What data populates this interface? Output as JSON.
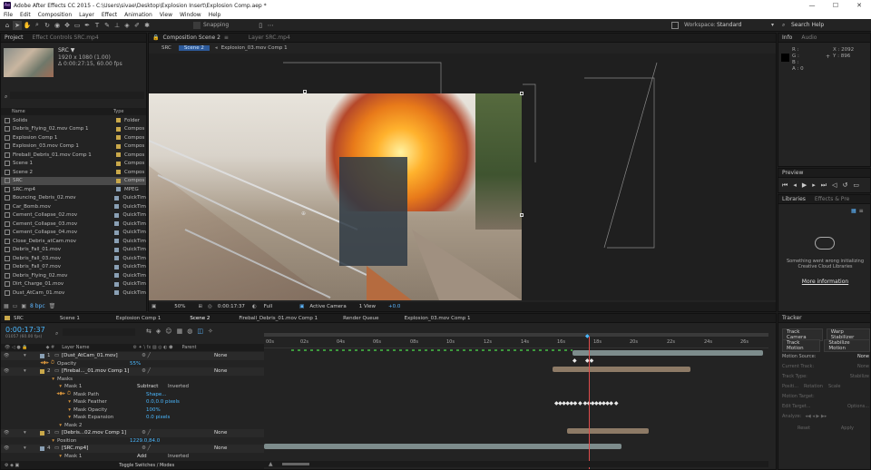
{
  "window": {
    "title": "Adobe After Effects CC 2015 - C:\\Users\\sivae\\Desktop\\Explosion Insert\\Explosion Comp.aep *",
    "controls": [
      "—",
      "☐",
      "✕"
    ]
  },
  "menu": [
    "File",
    "Edit",
    "Composition",
    "Layer",
    "Effect",
    "Animation",
    "View",
    "Window",
    "Help"
  ],
  "toolbar": {
    "snapping": "Snapping",
    "workspace_label": "Workspace:",
    "workspace_value": "Standard",
    "search_help": "Search Help"
  },
  "project": {
    "tab": "Project",
    "effect_controls": "Effect Controls SRC.mp4",
    "selected_name": "SRC ▼",
    "selected_res": "1920 x 1080 (1.00)",
    "selected_dur": "Δ 0:00:27:15, 60.00 fps",
    "col_name": "Name",
    "col_type": "Type",
    "bpc": "8 bpc",
    "items": [
      {
        "name": "Solids",
        "type": "Folder"
      },
      {
        "name": "Debris_Flying_02.mov Comp 1",
        "type": "Compos"
      },
      {
        "name": "Explosion Comp 1",
        "type": "Compos"
      },
      {
        "name": "Explosion_03.mov Comp 1",
        "type": "Compos"
      },
      {
        "name": "Fireball_Debris_01.mov Comp 1",
        "type": "Compos"
      },
      {
        "name": "Scene 1",
        "type": "Compos"
      },
      {
        "name": "Scene 2",
        "type": "Compos"
      },
      {
        "name": "SRC",
        "type": "Compos"
      },
      {
        "name": "SRC.mp4",
        "type": "MPEG"
      },
      {
        "name": "Bouncing_Debris_02.mov",
        "type": "QuickTim"
      },
      {
        "name": "Car_Bomb.mov",
        "type": "QuickTim"
      },
      {
        "name": "Cement_Collapse_02.mov",
        "type": "QuickTim"
      },
      {
        "name": "Cement_Collapse_03.mov",
        "type": "QuickTim"
      },
      {
        "name": "Cement_Collapse_04.mov",
        "type": "QuickTim"
      },
      {
        "name": "Close_Debris_atCam.mov",
        "type": "QuickTim"
      },
      {
        "name": "Debris_Fall_01.mov",
        "type": "QuickTim"
      },
      {
        "name": "Debris_Fall_03.mov",
        "type": "QuickTim"
      },
      {
        "name": "Debris_Fall_07.mov",
        "type": "QuickTim"
      },
      {
        "name": "Debris_Flying_02.mov",
        "type": "QuickTim"
      },
      {
        "name": "Dirt_Charge_01.mov",
        "type": "QuickTim"
      },
      {
        "name": "Dust_AtCam_01.mov",
        "type": "QuickTim"
      }
    ]
  },
  "composition": {
    "tab": "Composition Scene 2",
    "layer_tab": "Layer SRC.mp4",
    "flow": [
      "SRC",
      "Scene 2",
      "Explosion_03.mov Comp 1"
    ],
    "zoom": "50%",
    "timecode": "0:00:17:37",
    "resolution": "Full",
    "camera": "Active Camera",
    "view": "1 View",
    "exposure": "+0.0"
  },
  "info": {
    "tab": "Info",
    "audio": "Audio",
    "r": "R :",
    "g": "G :",
    "b": "B :",
    "a": "A : 0",
    "x": "X : 2092",
    "y": "Y : 896"
  },
  "preview": {
    "tab": "Preview"
  },
  "libraries": {
    "tab": "Libraries",
    "effects": "Effects & Pre",
    "error": "Something went wrong initializing Creative Cloud Libraries",
    "more_info": "More information"
  },
  "tracker": {
    "tab": "Tracker",
    "track_camera": "Track Camera",
    "warp_stabilizer": "Warp Stabilizer",
    "track_motion": "Track Motion",
    "stabilize_motion": "Stabilize Motion",
    "motion_source": "Motion Source:",
    "motion_source_val": "None",
    "current_track": "Current Track:",
    "current_track_val": "None",
    "track_type": "Track Type:",
    "track_type_val": "Stabilize",
    "position": "Positi...",
    "rotation": "Rotation",
    "scale": "Scale",
    "motion_target": "Motion Target:",
    "edit_target": "Edit Target...",
    "options": "Options...",
    "analyze": "Analyze:",
    "reset": "Reset",
    "apply": "Apply"
  },
  "timeline": {
    "tabs": [
      "SRC",
      "Scene 1",
      "Explosion Comp 1",
      "Scene 2",
      "Fireball_Debris_01.mov Comp 1",
      "Render Queue",
      "Explosion_03.mov Comp 1"
    ],
    "timecode": "0:00:17:37",
    "frame": "01057 (60.00 fps)",
    "col_layer": "Layer Name",
    "col_parent": "Parent",
    "ruler": [
      "00s",
      "02s",
      "04s",
      "06s",
      "08s",
      "10s",
      "12s",
      "14s",
      "16s",
      "18s",
      "20s",
      "22s",
      "24s",
      "26s"
    ],
    "footer": "Toggle Switches / Modes",
    "layers": [
      {
        "num": "1",
        "name": "[Dust_AtCam_01.mov]",
        "parent": "None"
      },
      {
        "prop": "Opacity",
        "value": "55%"
      },
      {
        "num": "2",
        "name": "[Firebal..._01.mov Comp 1]",
        "parent": "None"
      },
      {
        "prop": "Masks"
      },
      {
        "prop": "Mask 1",
        "mode": "Subtract",
        "inv": "Inverted"
      },
      {
        "prop": "Mask Path",
        "value": "Shape..."
      },
      {
        "prop": "Mask Feather",
        "value": "0.0,0.0 pixels"
      },
      {
        "prop": "Mask Opacity",
        "value": "100%"
      },
      {
        "prop": "Mask Expansion",
        "value": "0.0 pixels"
      },
      {
        "prop": "Mask 2"
      },
      {
        "num": "3",
        "name": "[Debris...02.mov Comp 1]",
        "parent": "None"
      },
      {
        "prop": "Position",
        "value": "1229.0,84.0"
      },
      {
        "num": "4",
        "name": "[SRC.mp4]",
        "parent": "None"
      },
      {
        "prop": "Mask 1",
        "mode": "Add",
        "inv": "Inverted"
      }
    ]
  },
  "colors": {
    "accent": "#2d8ceb",
    "playhead": "#e04b4b",
    "timecode": "#4ab8ff"
  }
}
